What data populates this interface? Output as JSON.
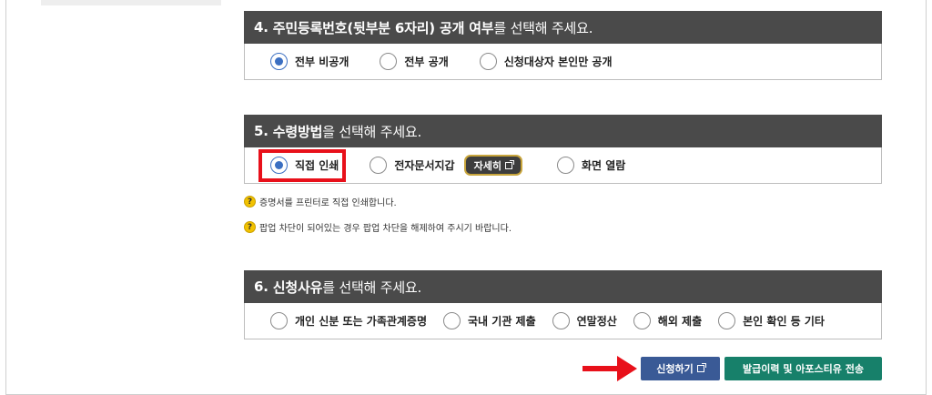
{
  "section4": {
    "num": "4.",
    "title_bold": "주민등록번호(뒷부분 6자리) 공개 여부",
    "title_rest": "를 선택해 주세요.",
    "options": [
      {
        "label": "전부 비공개",
        "selected": true
      },
      {
        "label": "전부 공개",
        "selected": false
      },
      {
        "label": "신청대상자 본인만 공개",
        "selected": false
      }
    ]
  },
  "section5": {
    "num": "5.",
    "title_bold": "수령방법",
    "title_rest": "을 선택해 주세요.",
    "options": [
      {
        "label": "직접 인쇄",
        "selected": true
      },
      {
        "label": "전자문서지갑",
        "selected": false
      },
      {
        "label": "화면 열람",
        "selected": false
      }
    ],
    "detail_button": "자세히"
  },
  "notes": [
    "증명서를 프린터로 직접 인쇄합니다.",
    "팝업 차단이 되어있는 경우 팝업 차단을 해제하여 주시기 바랍니다."
  ],
  "section6": {
    "num": "6.",
    "title_bold": "신청사유",
    "title_rest": "를 선택해 주세요.",
    "options": [
      {
        "label": "개인 신분 또는 가족관계증명",
        "selected": false
      },
      {
        "label": "국내 기관 제출",
        "selected": false
      },
      {
        "label": "연말정산",
        "selected": false
      },
      {
        "label": "해외 제출",
        "selected": false
      },
      {
        "label": "본인 확인 등 기타",
        "selected": false
      }
    ]
  },
  "buttons": {
    "apply": "신청하기",
    "history": "발급이력 및 아포스티유 전송"
  },
  "colors": {
    "header_bg": "#4a4a4a",
    "radio_selected": "#3b6fc2",
    "highlight": "#e8101a",
    "apply_btn": "#3a5a96",
    "history_btn": "#17806a",
    "help_icon": "#f2c200"
  },
  "icons": {
    "help": "?"
  }
}
